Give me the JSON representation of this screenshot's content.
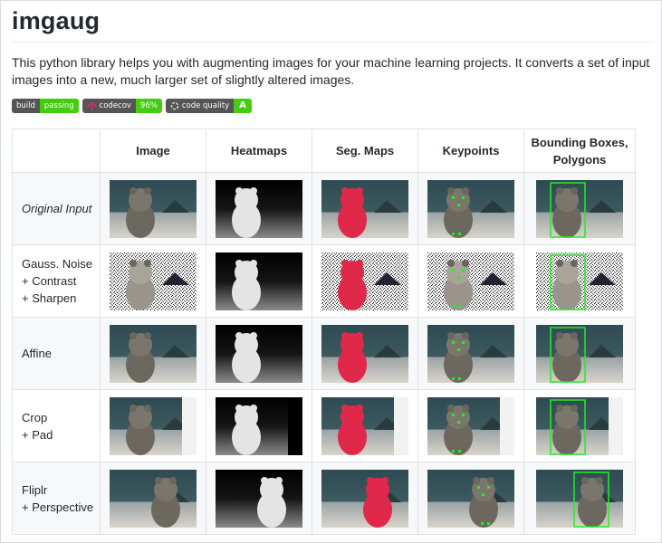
{
  "title": "imgaug",
  "description": "This python library helps you with augmenting images for your machine learning projects. It converts a set of input images into a new, much larger set of slightly altered images.",
  "badges": [
    {
      "left": "build",
      "right": "passing",
      "icon": ""
    },
    {
      "left": "codecov",
      "right": "96%",
      "icon": "codecov-umbrella-icon"
    },
    {
      "left": "code quality",
      "right": "A",
      "icon": "code-quality-icon"
    }
  ],
  "table": {
    "headers": [
      "",
      "Image",
      "Heatmaps",
      "Seg. Maps",
      "Keypoints",
      "Bounding Boxes, Polygons"
    ],
    "rows": [
      {
        "label": "Original Input",
        "italic": true
      },
      {
        "label": "Gauss. Noise\n+ Contrast\n+ Sharpen",
        "italic": false
      },
      {
        "label": "Affine",
        "italic": false
      },
      {
        "label": "Crop\n+ Pad",
        "italic": false
      },
      {
        "label": "Fliplr\n+ Perspective",
        "italic": false
      }
    ]
  },
  "colors": {
    "badge_left": "#555555",
    "badge_green": "#44cc11",
    "segmap_red": "#e0284a",
    "keypoint_green": "#22ee22"
  }
}
